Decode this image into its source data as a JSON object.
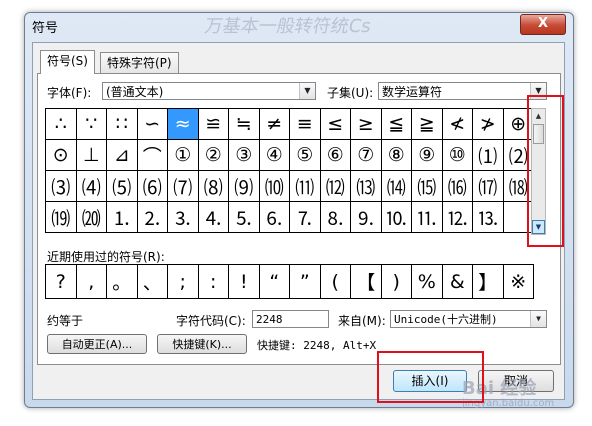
{
  "window": {
    "title": "符号",
    "close_glyph": "X",
    "bg_watermark": "万基本一般转符统Cs"
  },
  "tabs": [
    {
      "label": "符号(S)",
      "active": true
    },
    {
      "label": "特殊字符(P)",
      "active": false
    }
  ],
  "font": {
    "label": "字体(F):",
    "value": "(普通文本)"
  },
  "subset": {
    "label": "子集(U):",
    "value": "数学运算符"
  },
  "symbols": [
    "∴",
    "∵",
    "∷",
    "∽",
    "≈",
    "≌",
    "≒",
    "≠",
    "≡",
    "≤",
    "≥",
    "≦",
    "≧",
    "≮",
    "≯",
    "⊕",
    "⊙",
    "⊥",
    "⊿",
    "⌒",
    "①",
    "②",
    "③",
    "④",
    "⑤",
    "⑥",
    "⑦",
    "⑧",
    "⑨",
    "⑩",
    "⑴",
    "⑵",
    "⑶",
    "⑷",
    "⑸",
    "⑹",
    "⑺",
    "⑻",
    "⑼",
    "⑽",
    "⑾",
    "⑿",
    "⒀",
    "⒁",
    "⒂",
    "⒃",
    "⒄",
    "⒅",
    "⒆",
    "⒇",
    "⒈",
    "⒉",
    "⒊",
    "⒋",
    "⒌",
    "⒍",
    "⒎",
    "⒏",
    "⒐",
    "⒑",
    "⒒",
    "⒓",
    "⒔"
  ],
  "selected_symbol_index": 4,
  "recent": {
    "label": "近期使用过的符号(R):",
    "symbols": [
      "?",
      ",",
      "。",
      "、",
      ";",
      ":",
      "!",
      "“",
      "”",
      "(",
      "【",
      ")",
      "%",
      "&",
      "】",
      "※"
    ]
  },
  "char_name": "约等于",
  "char_code": {
    "label": "字符代码(C):",
    "value": "2248"
  },
  "from": {
    "label": "来自(M):",
    "value": "Unicode(十六进制)"
  },
  "buttons": {
    "autocorrect": "自动更正(A)...",
    "shortcut_key": "快捷键(K)...",
    "insert": "插入(I)",
    "cancel": "取消"
  },
  "shortcut_text": "快捷键: 2248, Alt+X",
  "watermark": {
    "main": "Bai 经验",
    "sub": "jingyan.baidu.com"
  },
  "highlight_color": "#e0101b",
  "selection_color": "#3399ff"
}
